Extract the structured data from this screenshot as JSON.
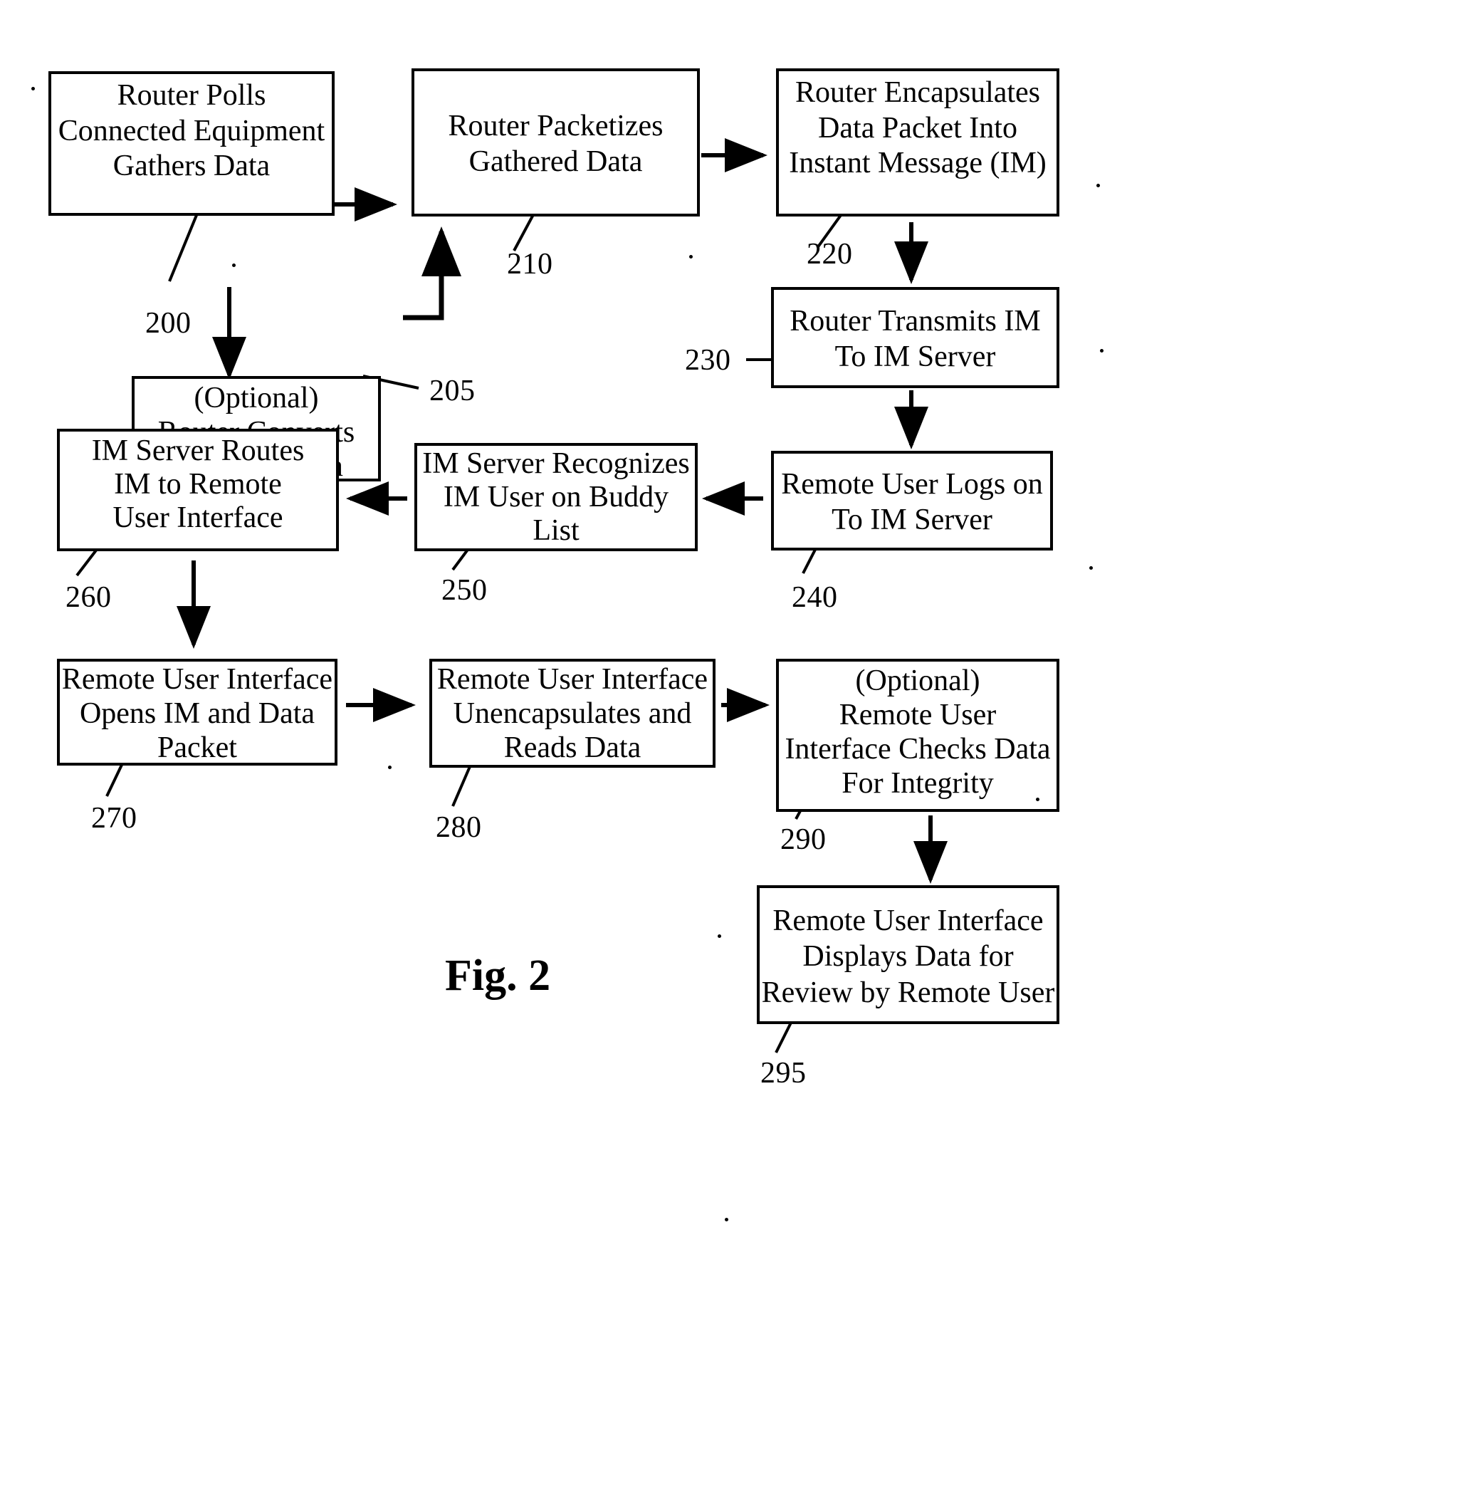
{
  "figure": {
    "label": "Fig. 2",
    "title": "Fig. 2"
  },
  "boxes": [
    {
      "id": "b200",
      "ref": "200",
      "lines": [
        "Router Polls",
        "Connected Equipment",
        "Gathers Data"
      ]
    },
    {
      "id": "b205",
      "ref": "205",
      "lines": [
        "(Optional)",
        "Router Converts",
        "Gathered Data"
      ]
    },
    {
      "id": "b210",
      "ref": "210",
      "lines": [
        "Router Packetizes",
        "Gathered Data"
      ]
    },
    {
      "id": "b220",
      "ref": "220",
      "lines": [
        "Router Encapsulates",
        "Data Packet Into",
        "Instant Message (IM)"
      ]
    },
    {
      "id": "b230",
      "ref": "230",
      "lines": [
        "Router Transmits IM",
        "To IM Server"
      ]
    },
    {
      "id": "b240",
      "ref": "240",
      "lines": [
        "Remote User Logs on",
        "To IM Server"
      ]
    },
    {
      "id": "b250",
      "ref": "250",
      "lines": [
        "IM Server Recognizes",
        "IM User on Buddy",
        "List"
      ]
    },
    {
      "id": "b260",
      "ref": "260",
      "lines": [
        "IM Server Routes",
        "IM to Remote",
        "User Interface"
      ]
    },
    {
      "id": "b270",
      "ref": "270",
      "lines": [
        "Remote User Interface",
        "Opens IM and Data",
        "Packet"
      ]
    },
    {
      "id": "b280",
      "ref": "280",
      "lines": [
        "Remote User Interface",
        "Unencapsulates and",
        "Reads Data"
      ]
    },
    {
      "id": "b290",
      "ref": "290",
      "lines": [
        "(Optional)",
        "Remote User",
        "Interface Checks Data",
        "For Integrity"
      ]
    },
    {
      "id": "b295",
      "ref": "295",
      "lines": [
        "Remote User Interface",
        "Displays Data for",
        "Review by Remote User"
      ]
    }
  ],
  "chart_data": {
    "type": "diagram",
    "title": "Fig. 2",
    "nodes": [
      {
        "ref": "200",
        "text": "Router Polls Connected Equipment Gathers Data"
      },
      {
        "ref": "205",
        "text": "(Optional) Router Converts Gathered Data"
      },
      {
        "ref": "210",
        "text": "Router Packetizes Gathered Data"
      },
      {
        "ref": "220",
        "text": "Router Encapsulates Data Packet Into Instant Message (IM)"
      },
      {
        "ref": "230",
        "text": "Router Transmits IM To IM Server"
      },
      {
        "ref": "240",
        "text": "Remote User Logs on To IM Server"
      },
      {
        "ref": "250",
        "text": "IM Server Recognizes IM User on Buddy List"
      },
      {
        "ref": "260",
        "text": "IM Server Routes IM to Remote User Interface"
      },
      {
        "ref": "270",
        "text": "Remote User Interface Opens IM and Data Packet"
      },
      {
        "ref": "280",
        "text": "Remote User Interface Unencapsulates and Reads Data"
      },
      {
        "ref": "290",
        "text": "(Optional) Remote User Interface Checks Data For Integrity"
      },
      {
        "ref": "295",
        "text": "Remote User Interface Displays Data for Review by Remote User"
      }
    ],
    "edges": [
      {
        "from": "200",
        "to": "210",
        "direction": "right"
      },
      {
        "from": "200",
        "to": "205",
        "direction": "down"
      },
      {
        "from": "205",
        "to": "210",
        "direction": "up-elbow"
      },
      {
        "from": "210",
        "to": "220",
        "direction": "right"
      },
      {
        "from": "220",
        "to": "230",
        "direction": "down"
      },
      {
        "from": "230",
        "to": "240",
        "direction": "down"
      },
      {
        "from": "240",
        "to": "250",
        "direction": "left"
      },
      {
        "from": "250",
        "to": "260",
        "direction": "left"
      },
      {
        "from": "260",
        "to": "270",
        "direction": "down"
      },
      {
        "from": "270",
        "to": "280",
        "direction": "right"
      },
      {
        "from": "280",
        "to": "290",
        "direction": "right"
      },
      {
        "from": "290",
        "to": "295",
        "direction": "down"
      }
    ]
  }
}
